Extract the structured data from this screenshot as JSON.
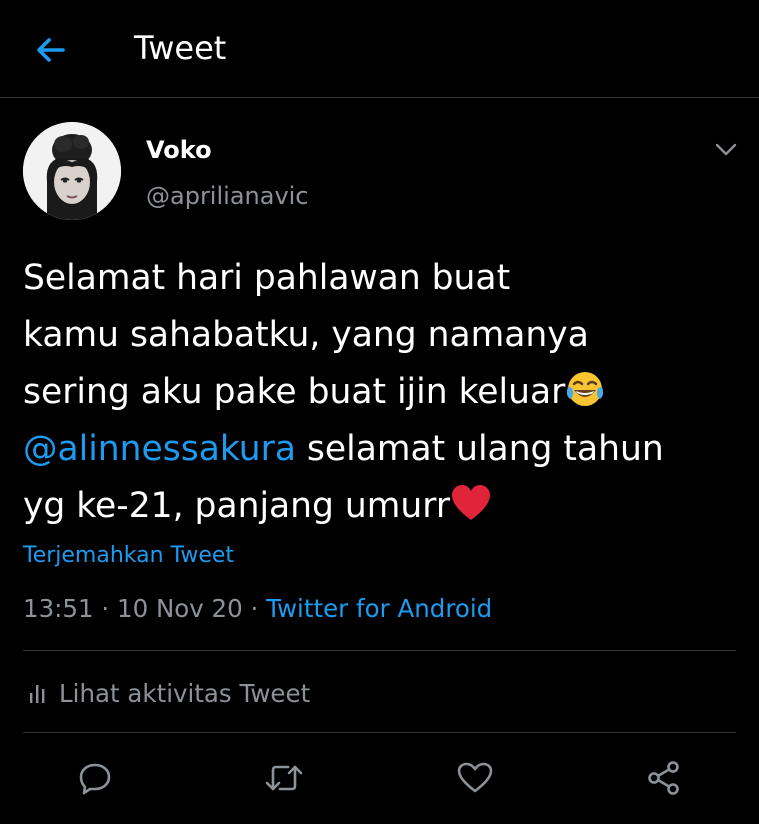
{
  "header": {
    "title": "Tweet",
    "back_icon": "arrow-left-icon"
  },
  "author": {
    "name": "Voko",
    "handle": "@aprilianavic"
  },
  "tweet": {
    "line1": "Selamat hari pahlawan buat",
    "line2": "kamu sahabatku, yang namanya",
    "line3": "sering aku pake buat ijin keluar",
    "line3_emoji": "face-with-tears-of-joy-emoji",
    "mention": "@alinnessakura",
    "line4_rest": " selamat ulang tahun",
    "line5": "yg ke-21, panjang umurr",
    "line5_emoji": "red-heart-emoji"
  },
  "translate_label": "Terjemahkan Tweet",
  "meta": {
    "time": "13:51",
    "separator": " · ",
    "date": "10 Nov 20",
    "source": "Twitter for Android"
  },
  "activity": {
    "label": "Lihat aktivitas Tweet",
    "icon": "bar-chart-icon"
  },
  "actions": [
    "reply-icon",
    "retweet-icon",
    "like-icon",
    "share-icon"
  ],
  "colors": {
    "background": "#000000",
    "text": "#ffffff",
    "secondary_text": "#8b9298",
    "accent": "#1d9bf0",
    "divider": "#2f3336"
  }
}
